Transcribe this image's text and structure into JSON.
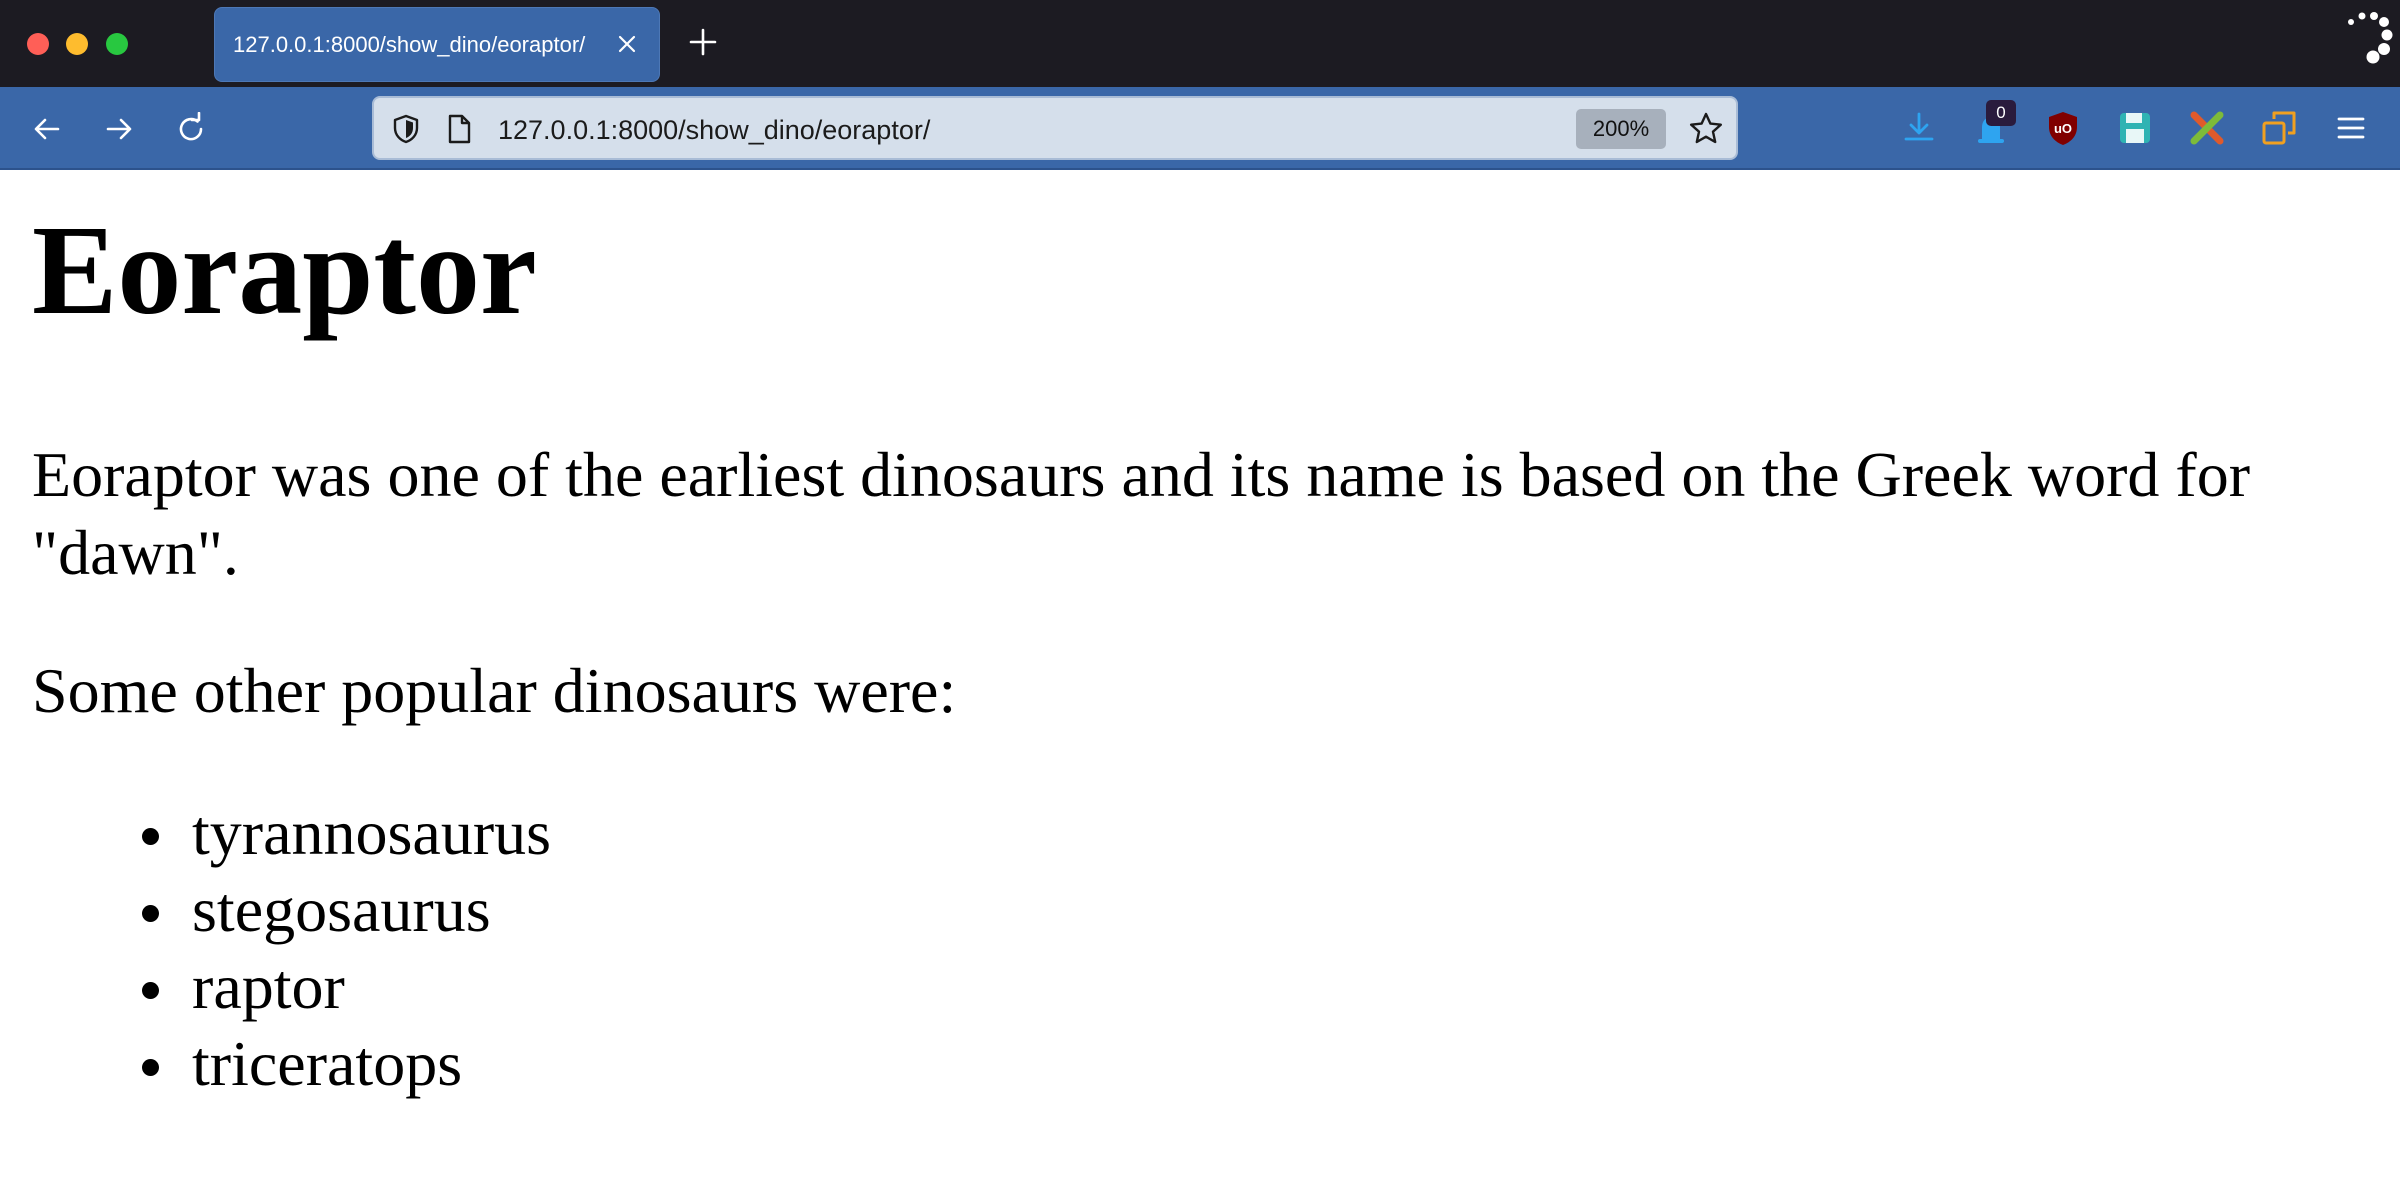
{
  "browser": {
    "tab": {
      "title": "127.0.0.1:8000/show_dino/eoraptor/"
    },
    "url": "127.0.0.1:8000/show_dino/eoraptor/",
    "zoom": "200%",
    "extension_badge_count": "0"
  },
  "icons": {
    "back": "arrow-left-icon",
    "forward": "arrow-right-icon",
    "reload": "reload-icon",
    "shield": "shield-icon",
    "page": "page-icon",
    "star": "star-icon",
    "download": "download-icon",
    "menu": "hamburger-menu-icon"
  },
  "colors": {
    "titlebar": "#1c1b22",
    "toolbar": "#3a67a8",
    "urlbar": "#d5dfeb"
  },
  "page": {
    "title": "Eoraptor",
    "description": "Eoraptor was one of the earliest dinosaurs and its name is based on the Greek word for \"dawn\".",
    "list_intro": "Some other popular dinosaurs were:",
    "dinosaurs": [
      "tyrannosaurus",
      "stegosaurus",
      "raptor",
      "triceratops"
    ]
  }
}
